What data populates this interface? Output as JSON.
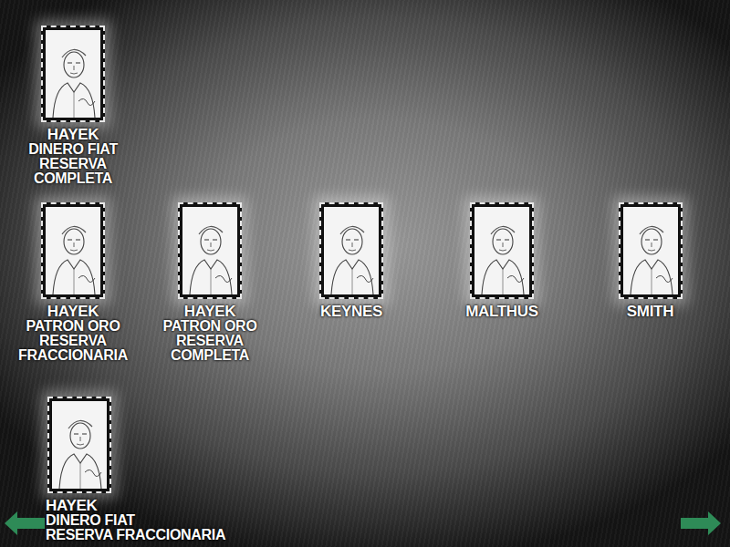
{
  "cards": [
    {
      "lines": [
        "HAYEK",
        "DINERO FIAT",
        "RESERVA",
        "COMPLETA"
      ]
    },
    {
      "lines": [
        "HAYEK",
        "PATRON ORO",
        "RESERVA",
        "FRACCIONARIA"
      ]
    },
    {
      "lines": [
        "HAYEK",
        "PATRON ORO",
        "RESERVA",
        "COMPLETA"
      ]
    },
    {
      "lines": [
        "KEYNES"
      ]
    },
    {
      "lines": [
        "MALTHUS"
      ]
    },
    {
      "lines": [
        "SMITH"
      ]
    },
    {
      "lines": [
        "HAYEK",
        "DINERO FIAT",
        "RESERVA FRACCIONARIA"
      ]
    }
  ]
}
